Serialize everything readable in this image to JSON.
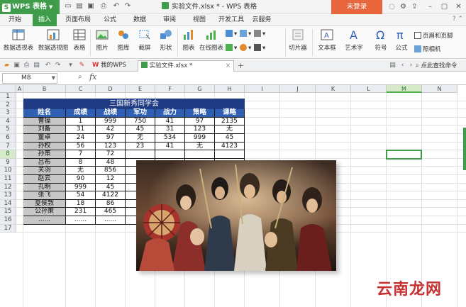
{
  "titlebar": {
    "app_name": "WPS 表格",
    "window_title": "实验文件.xlsx * - WPS 表格",
    "login_label": "未登录"
  },
  "tabs": [
    "开始",
    "插入",
    "页面布局",
    "公式",
    "数据",
    "审阅",
    "视图",
    "开发工具",
    "云服务"
  ],
  "active_tab": "插入",
  "ribbon": {
    "pivot_table": "数据透视表",
    "pivot_chart": "数据透视图",
    "table": "表格",
    "picture": "图片",
    "gallery": "图库",
    "screenshot": "截屏",
    "shapes": "形状",
    "chart": "图表",
    "online_chart": "在线图表",
    "slicer": "切片器",
    "textbox": "文本框",
    "wordart": "艺术字",
    "symbol": "符号",
    "formula": "公式",
    "header_footer": "页眉和页脚",
    "camera": "照相机"
  },
  "doctabs": {
    "my_wps": "我的WPS",
    "file": "实验文件.xlsx *",
    "search": "点此查找命令"
  },
  "formula_bar": {
    "name_box": "M8",
    "fx": "fx"
  },
  "columns": [
    "A",
    "B",
    "C",
    "D",
    "E",
    "F",
    "G",
    "H",
    "I",
    "J",
    "K",
    "L",
    "M",
    "N"
  ],
  "selected_column": "M",
  "rows": [
    "1",
    "2",
    "3",
    "4",
    "5",
    "6",
    "7",
    "8",
    "9",
    "10",
    "11",
    "12",
    "13",
    "14",
    "15",
    "16",
    "17"
  ],
  "selected_row": "8",
  "table": {
    "title": "三国新秀同学会",
    "headers": [
      "姓名",
      "成绩",
      "战绩",
      "军功",
      "战力",
      "策略",
      "课略"
    ],
    "rows": [
      [
        "曹操",
        "1",
        "999",
        "750",
        "41",
        "97",
        "2135"
      ],
      [
        "刘备",
        "31",
        "42",
        "45",
        "31",
        "123",
        "无"
      ],
      [
        "董卓",
        "24",
        "97",
        "无",
        "534",
        "999",
        "45"
      ],
      [
        "孙权",
        "56",
        "123",
        "23",
        "41",
        "无",
        "4123"
      ],
      [
        "孙策",
        "7",
        "72",
        "",
        "",
        "",
        ""
      ],
      [
        "吕布",
        "8",
        "48",
        "",
        "",
        "",
        ""
      ],
      [
        "关羽",
        "无",
        "856",
        "",
        "",
        "",
        ""
      ],
      [
        "赵云",
        "90",
        "12",
        "",
        "",
        "",
        ""
      ],
      [
        "孔明",
        "999",
        "45",
        "",
        "",
        "",
        ""
      ],
      [
        "张飞",
        "54",
        "4122",
        "",
        "",
        "",
        ""
      ],
      [
        "夏侯敦",
        "18",
        "86",
        "",
        "",
        "",
        ""
      ],
      [
        "公孙策",
        "231",
        "465",
        "",
        "",
        "",
        ""
      ],
      [
        "......",
        "......",
        "......",
        "",
        "",
        "",
        ""
      ]
    ]
  },
  "watermark": "云南龙网",
  "colors": {
    "brand_green": "#3f9c4a",
    "login_orange": "#e9663c",
    "table_title_bg": "#1f3b83",
    "table_header_bg": "#2f5fb3",
    "name_col_bg": "#c7c7c7"
  }
}
